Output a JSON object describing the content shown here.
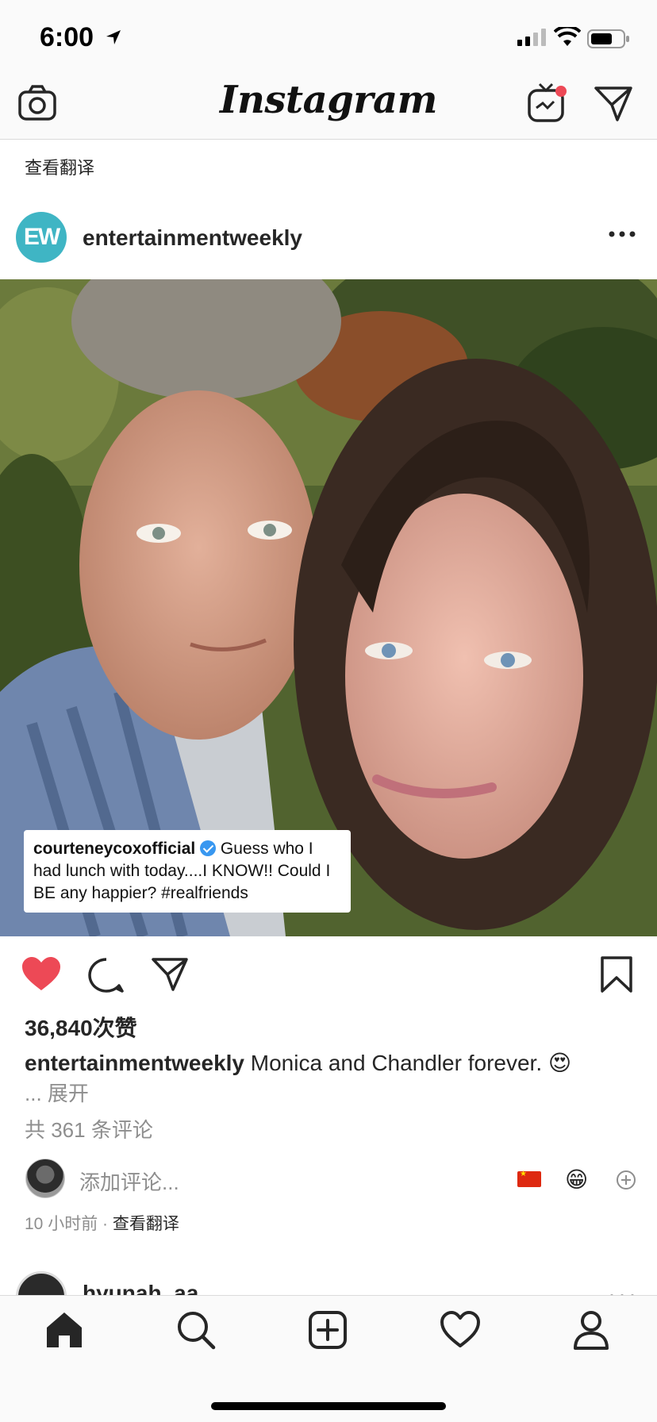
{
  "status_bar": {
    "time": "6:00"
  },
  "nav": {
    "logo": "Instagram"
  },
  "previous_post": {
    "translate_label": "查看翻译"
  },
  "post": {
    "avatar_initials": "EW",
    "username": "entertainmentweekly",
    "image_caption": {
      "user": "courteneycoxofficial",
      "text": "Guess who I had lunch with today....I KNOW!! Could I BE any happier? #realfriends"
    },
    "likes": "36,840次赞",
    "caption_user": "entertainmentweekly",
    "caption_text": "Monica and Chandler forever. 😍",
    "more_label": "... 展开",
    "view_comments": "共 361 条评论",
    "comment_placeholder": "添加评论...",
    "quick_emoji": "😁",
    "time_ago": "10 小时前 · ",
    "translate_label": "查看翻译",
    "liked": true
  },
  "next_post": {
    "username": "hyunah_aa"
  },
  "colors": {
    "like_red": "#ed4956",
    "ew_teal": "#3fb5c4",
    "verified_blue": "#3897f0"
  }
}
